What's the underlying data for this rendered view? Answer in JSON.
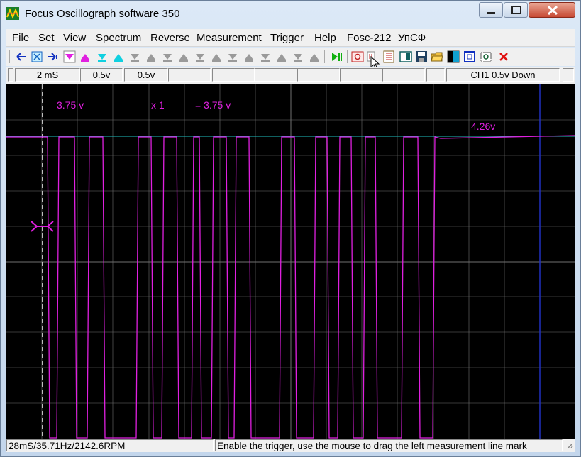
{
  "window": {
    "title": "Focus Oscillograph software 350"
  },
  "menu": [
    "File",
    "Set",
    "View",
    "Spectrum",
    "Reverse",
    "Measurement",
    "Trigger",
    "Help",
    "Fosc-212",
    "УпСФ"
  ],
  "toolbar": {
    "icons": [
      "arrow-left-icon",
      "zoom-fit-icon",
      "arrow-right-icon",
      "magenta-down-triangle-icon",
      "magenta-up-triangle-icon",
      "cyan-down-triangle-icon",
      "cyan-up-triangle-icon",
      "gray-down-triangle-icon",
      "gray-up-triangle-icon",
      "play-pause-icon",
      "capture-icon",
      "cursor-icon",
      "list-icon",
      "layout-icon",
      "save-icon",
      "open-folder-icon",
      "contrast-icon",
      "frame-icon",
      "settings-icon",
      "close-red-icon"
    ]
  },
  "status": {
    "timebase": "2 mS",
    "ch1_volts": "0.5v",
    "ch2_volts": "0.5v",
    "trigger": "CH1 0.5v Down"
  },
  "scope": {
    "colors": {
      "background": "#000000",
      "trace": "#e020e0",
      "grid": "#707070",
      "trigger_line": "#20c0c0",
      "cursor": "#2030c0"
    },
    "labels": {
      "measure_value": "3.75 v",
      "multiplier": "x 1",
      "result": "= 3.75 v",
      "high_level": "4.26v"
    }
  },
  "statusbar": {
    "measurement": "28mS/35.71Hz/2142.6RPM",
    "hint": "Enable the trigger, use the mouse to drag the left measurement line mark"
  }
}
